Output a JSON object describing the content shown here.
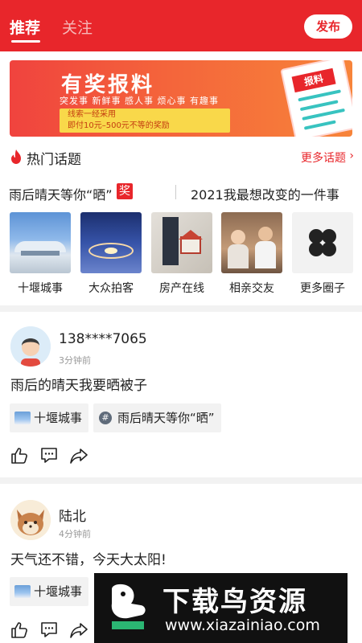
{
  "header": {
    "tabs": [
      {
        "label": "推荐",
        "active": true
      },
      {
        "label": "关注",
        "active": false
      }
    ],
    "publish_label": "发布"
  },
  "banner": {
    "title": "有奖报料",
    "categories": "突发事  新鲜事  感人事  烦心事  有趣事",
    "reward_line1": "线索一经采用",
    "reward_line2": "即付10元–500元不等的奖励",
    "paper_tag": "报料"
  },
  "hot_topics": {
    "title": "热门话题",
    "more_label": "更多话题",
    "topics": [
      {
        "text": "雨后晴天等你“晒”",
        "badge": "奖"
      },
      {
        "text": "2021我最想改变的一件事"
      }
    ]
  },
  "circles": [
    {
      "label": "十堰城事",
      "icon": "stadium-photo"
    },
    {
      "label": "大众拍客",
      "icon": "night-city-photo"
    },
    {
      "label": "房产在线",
      "icon": "house-model-photo"
    },
    {
      "label": "相亲交友",
      "icon": "couple-photo"
    },
    {
      "label": "更多圈子",
      "icon": "grid-icon"
    }
  ],
  "posts": [
    {
      "username": "138****7065",
      "time": "3分钟前",
      "content": "雨后的晴天我要晒被子",
      "tags": [
        {
          "label": "十堰城事",
          "kind": "circle"
        },
        {
          "label": "雨后晴天等你“晒”",
          "kind": "topic"
        }
      ],
      "avatar": "man-avatar"
    },
    {
      "username": "陆北",
      "time": "4分钟前",
      "content": "天气还不错，今天大太阳!",
      "tags": [
        {
          "label": "十堰城事",
          "kind": "circle"
        }
      ],
      "avatar": "fox-avatar"
    }
  ],
  "watermark": {
    "title": "下载鸟资源",
    "url": "www.xiazainiao.com"
  },
  "colors": {
    "brand_red": "#e8262b",
    "divider_gray": "#f2f2f2",
    "banner_teal": "#38c3c0",
    "banner_yellow": "#f9d84a"
  }
}
